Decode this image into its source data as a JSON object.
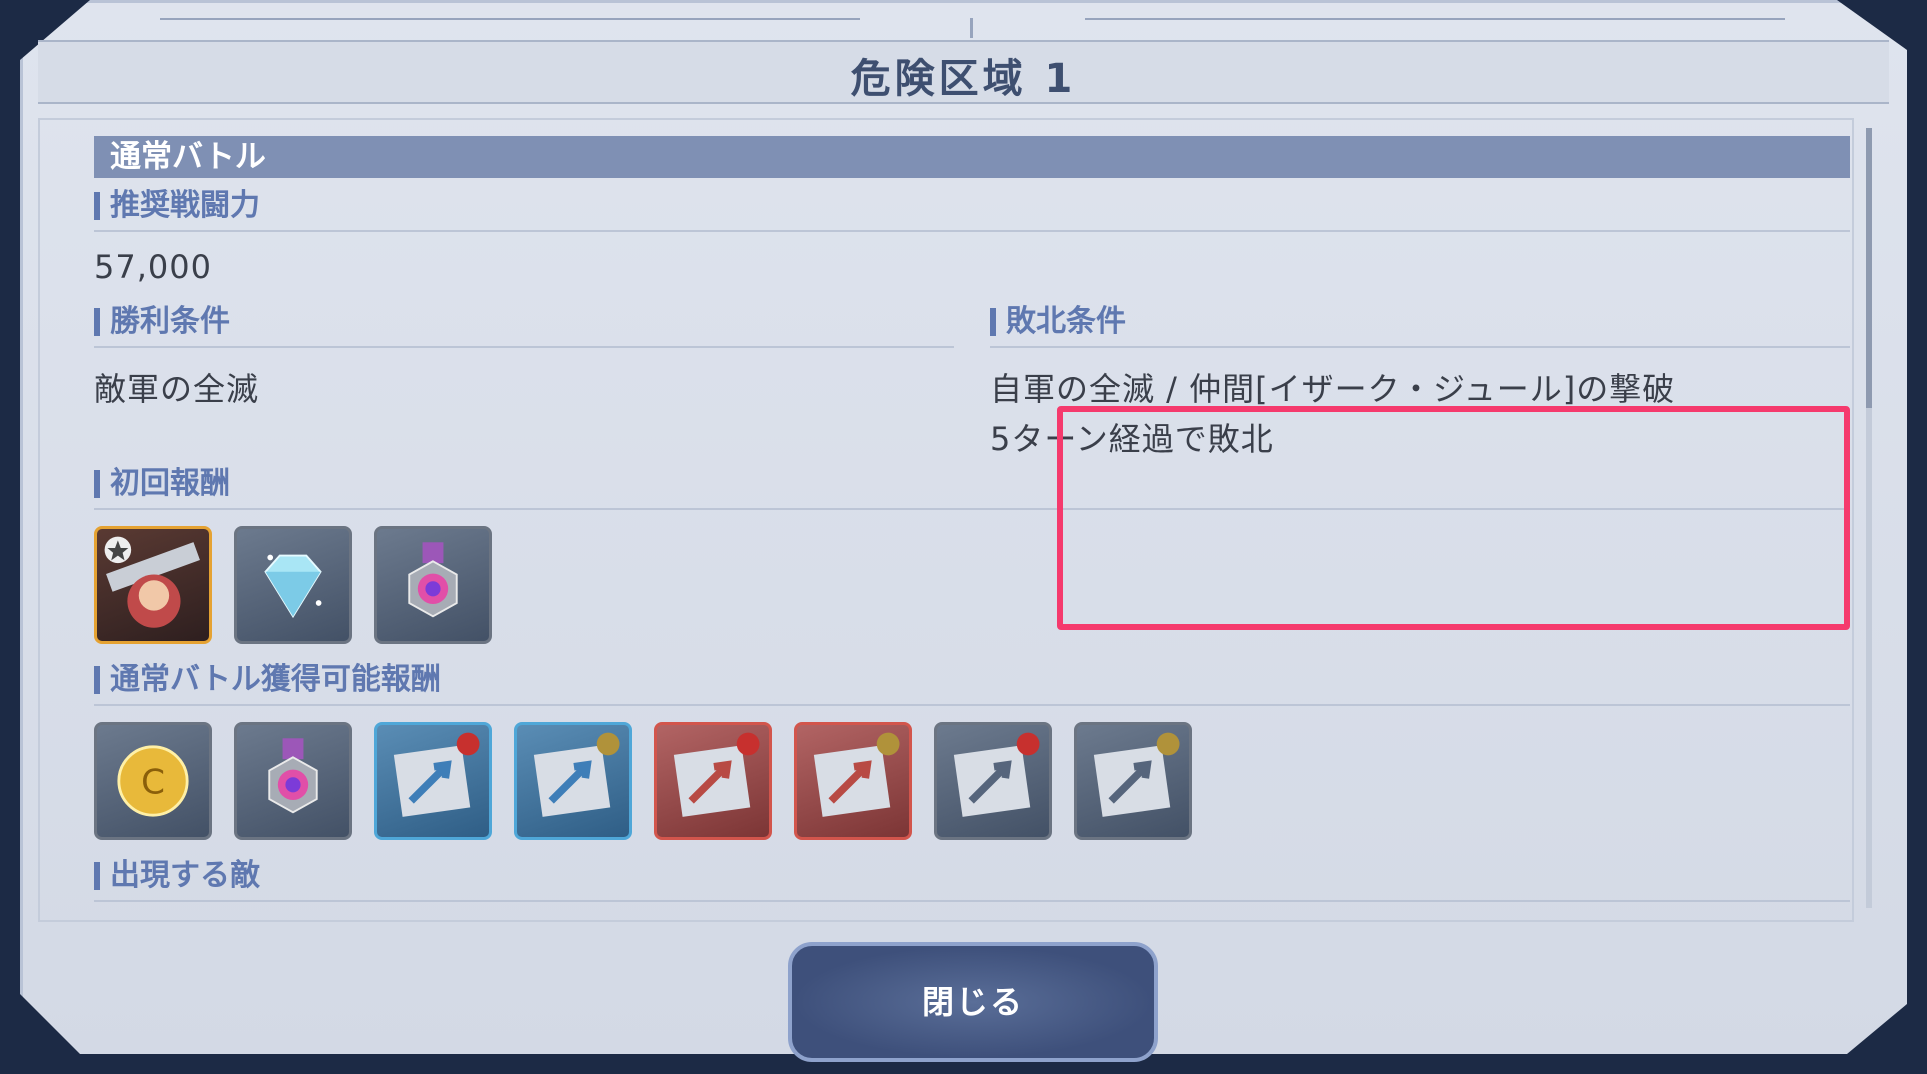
{
  "dialog": {
    "title": "危険区域 1",
    "section_header": "通常バトル",
    "recommended_power": {
      "label": "推奨戦闘力",
      "value": "57,000"
    },
    "victory": {
      "label": "勝利条件",
      "value": "敵軍の全滅"
    },
    "defeat": {
      "label": "敗北条件",
      "line1": "自軍の全滅 / 仲間[イザーク・ジュール]の撃破",
      "line2": "5ターン経過で敗北"
    },
    "first_reward": {
      "label": "初回報酬",
      "items": [
        {
          "icon": "character-card-icon",
          "frame": "gold"
        },
        {
          "icon": "diamond-icon",
          "frame": "gray"
        },
        {
          "icon": "medal-icon",
          "frame": "gray"
        }
      ]
    },
    "battle_reward": {
      "label": "通常バトル獲得可能報酬",
      "items": [
        {
          "icon": "coin-icon",
          "frame": "gray"
        },
        {
          "icon": "medal-icon",
          "frame": "gray"
        },
        {
          "icon": "upgrade-chip-blue-icon",
          "frame": "blue"
        },
        {
          "icon": "upgrade-chip-blue-icon",
          "frame": "blue"
        },
        {
          "icon": "upgrade-chip-red-icon",
          "frame": "red"
        },
        {
          "icon": "upgrade-chip-red-icon",
          "frame": "red"
        },
        {
          "icon": "upgrade-chip-gray-icon",
          "frame": "gray"
        },
        {
          "icon": "upgrade-chip-gray-icon",
          "frame": "gray"
        }
      ]
    },
    "enemies": {
      "label": "出現する敵"
    },
    "close_label": "閉じる"
  },
  "colors": {
    "accent": "#5f78b0",
    "highlight": "#f53a6d",
    "header_bar": "#7f90b4"
  }
}
